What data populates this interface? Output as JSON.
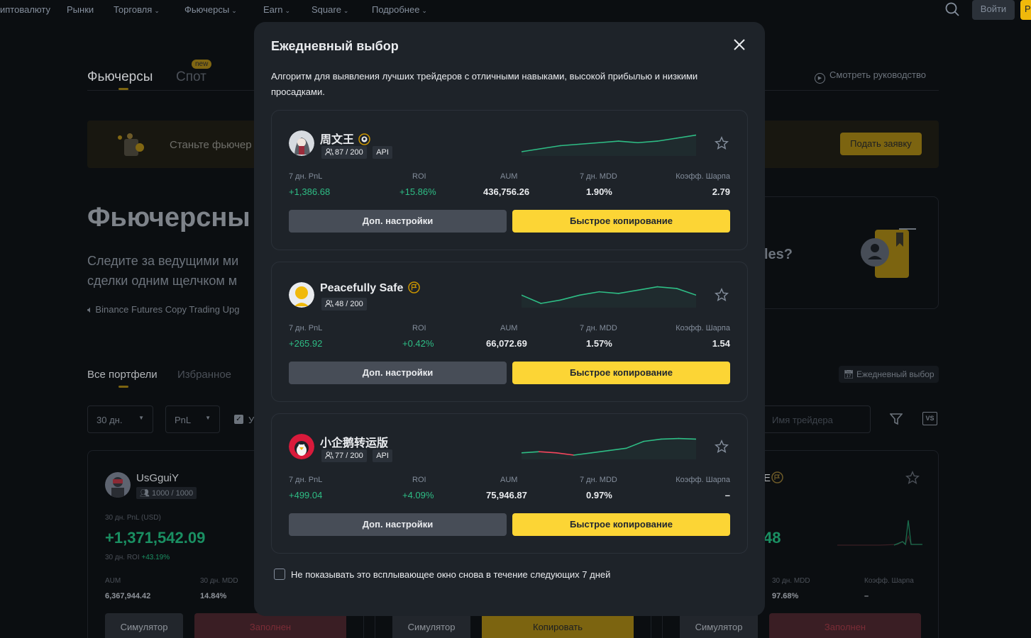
{
  "topnav": {
    "items": [
      "иптовалюту",
      "Рынки",
      "Торговля",
      "Фьючерсы",
      "Earn",
      "Square",
      "Подробнее"
    ],
    "login": "Войти",
    "register": "Р"
  },
  "background": {
    "tabs": [
      "Фьючерсы",
      "Спот"
    ],
    "new_badge": "new",
    "guide": "Смотреть руководство",
    "banner_text": "Станьте фьючер",
    "apply_button": "Подать заявку",
    "hero_title": "Фьючерсны",
    "hero_subtitle_1": "Следите за ведущими ми",
    "hero_subtitle_2": "сделки одним щелчком м",
    "announcement": "Binance Futures Copy Trading Upg",
    "promo_text": "les?",
    "list_tabs": [
      "Все портфели",
      "Избранное"
    ],
    "daily_pick_button": "Ежедневный выбор",
    "filter_period": "30 дн.",
    "filter_sort": "PnL",
    "filter_check_label": "У",
    "search_placeholder": "Имя трейдера",
    "vs": "VS",
    "cards": [
      {
        "name": "UsGguiY",
        "followers": "1000 / 1000",
        "pnl_label": "30 дн. PnL (USD)",
        "pnl": "+1,371,542.09",
        "roi_label": "30 дн. ROI",
        "roi": "+43.19%",
        "aum_label": "AUM",
        "aum": "6,367,944.42",
        "mdd_label": "30 дн. MDD",
        "mdd": "14.84%",
        "sim": "Симулятор",
        "action": "Заполнен"
      },
      {
        "sim": "Симулятор",
        "action": "Копировать"
      },
      {
        "name_tail": "E",
        "pnl_tail": "48",
        "mdd_label": "30 дн. MDD",
        "mdd": "97.68%",
        "sharpe_label": "Коэфф. Шарпа",
        "sharpe": "–",
        "sim": "Симулятор",
        "action": "Заполнен"
      }
    ]
  },
  "modal": {
    "title": "Ежедневный выбор",
    "description": "Алгоритм для выявления лучших трейдеров с отличными навыками, высокой прибылью и низкими просадками.",
    "metric_labels": [
      "7 дн. PnL",
      "ROI",
      "AUM",
      "7 дн. MDD",
      "Коэфф. Шарпа"
    ],
    "settings_label": "Доп. настройки",
    "copy_label": "Быстрое копирование",
    "dont_show": "Не показывать это всплывающее окно снова в течение следующих 7 дней",
    "traders": [
      {
        "name": "周文王",
        "followers": "87 / 200",
        "api": "API",
        "pnl": "+1,386.68",
        "roi": "+15.86%",
        "aum": "436,756.26",
        "mdd": "1.90%",
        "sharpe": "2.79",
        "spark": [
          5,
          6,
          7,
          7.5,
          8,
          8.5,
          8,
          8.5,
          9.5,
          10.5
        ]
      },
      {
        "name": "Peacefully Safe",
        "followers": "48 / 200",
        "api": "",
        "pnl": "+265.92",
        "roi": "+0.42%",
        "aum": "66,072.69",
        "mdd": "1.57%",
        "sharpe": "1.54",
        "spark": [
          9,
          8.5,
          8.7,
          9,
          9.2,
          9.1,
          9.3,
          9.5,
          9.4,
          9
        ]
      },
      {
        "name": "小企鹅转运版",
        "followers": "77 / 200",
        "api": "API",
        "pnl": "+499.04",
        "roi": "+4.09%",
        "aum": "75,946.87",
        "mdd": "0.97%",
        "sharpe": "–",
        "spark": [
          5,
          6,
          5,
          3,
          5,
          7,
          9,
          15,
          17,
          17.5,
          17
        ]
      }
    ]
  },
  "colors": {
    "accent": "#fcd535",
    "positive": "#2ebd85",
    "negative": "#f6465d",
    "modal_bg": "#1e2329",
    "page_bg": "#0b0e11"
  }
}
